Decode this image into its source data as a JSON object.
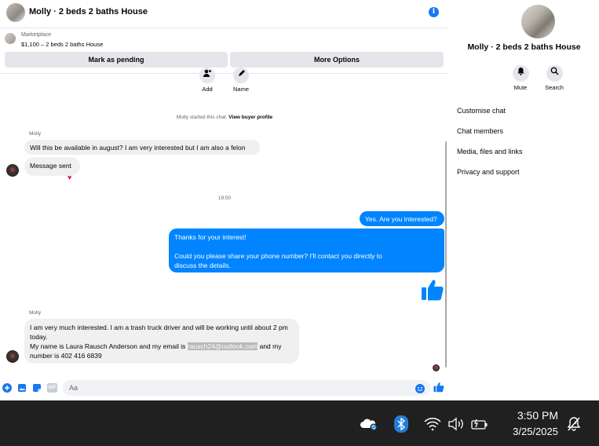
{
  "chat": {
    "title": "Molly · 2 beds 2 baths House",
    "info_icon": "i"
  },
  "marketplace": {
    "label": "Marketplace",
    "listing": "$1,100 – 2 beds 2 baths House",
    "mark_pending": "Mark as pending",
    "more_options": "More Options"
  },
  "quick_actions": {
    "add_label": "Add",
    "name_label": "Name"
  },
  "system": {
    "started": "Molly started this chat.",
    "view_profile": "View buyer profile",
    "time": "19:50"
  },
  "messages": {
    "sender1": "Molly",
    "msg1": "Will this be available in august? I am very interested but I am also a felon",
    "msg2": "Message sent",
    "reaction": "♥",
    "out1": "Yes. Are you interested?",
    "out2_line1": "Thanks for your interest!",
    "out2_line2": "Could you please share your phone number? I'll contact you directly to discuss the details.",
    "sender2": "Molly",
    "msg3_part1": "I am very much interested.  I am a trash truck driver and will be working until about 2 pm today.",
    "msg3_part2": "My name is Laura Rausch Anderson and my email is ",
    "msg3_email": "rausch24@outlook.com",
    "msg3_part3": " and my number is 402 416 6839"
  },
  "composer": {
    "placeholder": "Aa",
    "icons": [
      "plus-icon",
      "photo-icon",
      "sticker-icon",
      "gif-icon",
      "emoji-icon",
      "like-icon"
    ],
    "gif": "GIF"
  },
  "right_panel": {
    "title": "Molly · 2 beds 2 baths House",
    "mute": "Mute",
    "search": "Search",
    "items": [
      "Customise chat",
      "Chat members",
      "Media, files and links",
      "Privacy and support"
    ]
  },
  "taskbar": {
    "time": "3:50 PM",
    "date": "3/25/2025"
  },
  "colors": {
    "accent": "#1877f2",
    "outgoing": "#0084ff",
    "taskbar": "#202020"
  }
}
